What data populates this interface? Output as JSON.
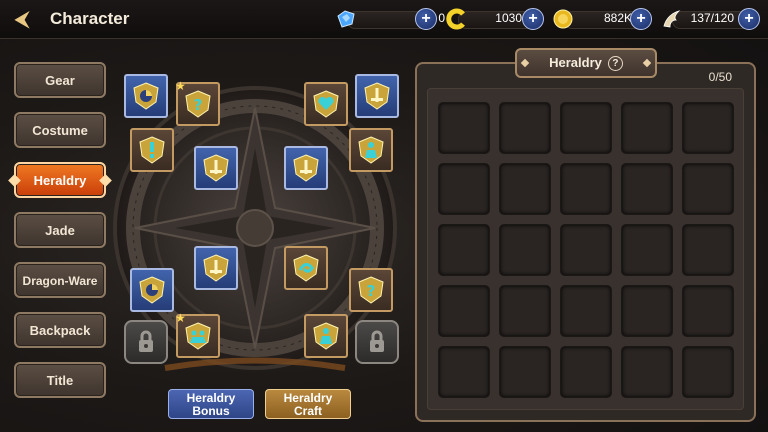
{
  "header": {
    "title": "Character"
  },
  "currencies": [
    {
      "name": "blue-gem",
      "value": "0"
    },
    {
      "name": "yellow-c",
      "value": "1030"
    },
    {
      "name": "gold-coin",
      "value": "882K"
    },
    {
      "name": "stamina-wing",
      "value": "137/120"
    }
  ],
  "menu": [
    {
      "label": "Gear"
    },
    {
      "label": "Costume"
    },
    {
      "label": "Heraldry",
      "active": true
    },
    {
      "label": "Jade"
    },
    {
      "label": "Dragon-Ware"
    },
    {
      "label": "Backpack"
    },
    {
      "label": "Title"
    }
  ],
  "emblem_slots": [
    {
      "style": "blue",
      "icon": "shield-pie-icon"
    },
    {
      "style": "brown",
      "icon": "shield-question-icon",
      "star": true
    },
    {
      "style": "brown",
      "icon": "shield-heart-icon"
    },
    {
      "style": "blue",
      "icon": "shield-sword-icon"
    },
    {
      "style": "brown",
      "icon": "shield-exclaim-icon"
    },
    {
      "style": "blue",
      "icon": "shield-sword-icon"
    },
    {
      "style": "blue",
      "icon": "shield-sword-icon"
    },
    {
      "style": "brown",
      "icon": "shield-person-icon"
    },
    {
      "style": "blue",
      "icon": "shield-pie-icon"
    },
    {
      "style": "blue",
      "icon": "shield-sword-icon"
    },
    {
      "style": "brown",
      "icon": "shield-swirl-icon"
    },
    {
      "style": "brown",
      "icon": "shield-question-icon"
    },
    {
      "style": "gray",
      "icon": "lock-icon"
    },
    {
      "style": "brown",
      "icon": "shield-group-icon",
      "star": true
    },
    {
      "style": "brown",
      "icon": "shield-person-icon"
    },
    {
      "style": "gray",
      "icon": "lock-icon"
    }
  ],
  "bottom_buttons": {
    "bonus": [
      "Heraldry",
      "Bonus"
    ],
    "craft": [
      "Heraldry",
      "Craft"
    ]
  },
  "panel": {
    "title": "Heraldry",
    "help": "?",
    "count": "0/50",
    "grid_cells": 25
  },
  "colors": {
    "accent_orange": "#e2581a",
    "slot_blue": "#3454a0",
    "slot_brown": "#4a392c",
    "plus_blue": "#2a4590"
  }
}
